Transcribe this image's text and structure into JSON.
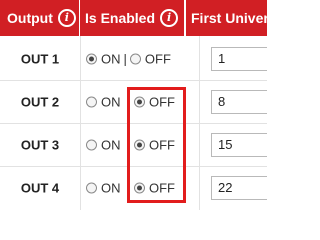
{
  "header": {
    "output_label": "Output",
    "enabled_label": "Is Enabled",
    "universe_label": "First Univer",
    "info_glyph": "i"
  },
  "rows": [
    {
      "label": "OUT 1",
      "on_label": "ON",
      "separator": "|",
      "off_label": "OFF",
      "enabled": true,
      "universe": "1"
    },
    {
      "label": "OUT 2",
      "on_label": "ON",
      "separator": "",
      "off_label": "OFF",
      "enabled": false,
      "universe": "8"
    },
    {
      "label": "OUT 3",
      "on_label": "ON",
      "separator": "",
      "off_label": "OFF",
      "enabled": false,
      "universe": "15"
    },
    {
      "label": "OUT 4",
      "on_label": "ON",
      "separator": "",
      "off_label": "OFF",
      "enabled": false,
      "universe": "22"
    }
  ],
  "colors": {
    "header_bg": "#d11f24",
    "highlight": "#e21c1c"
  }
}
